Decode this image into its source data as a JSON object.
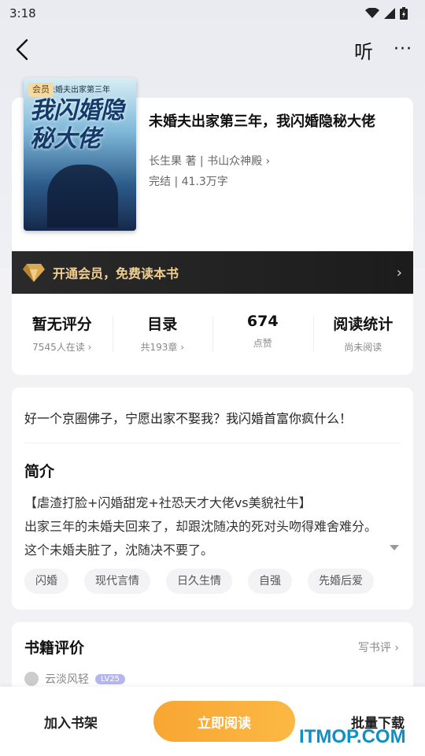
{
  "status_bar": {
    "time": "3:18"
  },
  "nav": {
    "listen_label": "听",
    "more_label": "···"
  },
  "book": {
    "vip_badge": "会员",
    "cover_title": "我闪婚隐秘大佬",
    "cover_subtitle": "未婚夫出家第三年",
    "title": "未婚夫出家第三年，我闪婚隐秘大佬",
    "author_line": "长生果 著 | 书山众神殿 ›",
    "status_line": "完结 | 41.3万字"
  },
  "vip_bar": {
    "text": "开通会员，免费读本书",
    "arrow": "›"
  },
  "stats": [
    {
      "value": "暂无评分",
      "label": "7545人在读 ›"
    },
    {
      "value": "目录",
      "label": "共193章 ›"
    },
    {
      "value": "674",
      "label": "点赞"
    },
    {
      "value": "阅读统计",
      "label": "尚未阅读"
    }
  ],
  "intro": {
    "tagline": "好一个京圈佛子，宁愿出家不娶我？我闪婚首富你疯什么！",
    "heading": "简介",
    "lines": [
      "【虐渣打脸+闪婚甜宠+社恐天才大佬vs美貌社牛】",
      "出家三年的未婚夫回来了，却跟沈随决的死对头吻得难舍难分。",
      "这个未婚夫脏了，沈随决不要了。"
    ],
    "tags": [
      "闪婚",
      "现代言情",
      "日久生情",
      "自强",
      "先婚后爱"
    ]
  },
  "reviews": {
    "heading": "书籍评价",
    "write_label": "写书评 ›",
    "first_reviewer": {
      "name": "云淡风轻",
      "level": "LV25"
    }
  },
  "bottom": {
    "shelf_label": "加入书架",
    "read_label": "立即阅读",
    "batch_label": "批量下载"
  },
  "watermark": "ITMOP.COM",
  "colors": {
    "accent": "#f8a632",
    "vip_gold": "#f1cf8f",
    "vip_bar": "#222222"
  }
}
